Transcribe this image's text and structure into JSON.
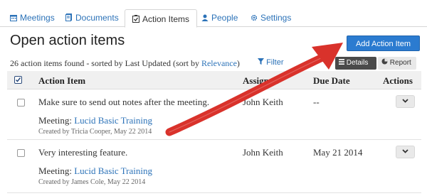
{
  "tabs": [
    {
      "label": "Meetings",
      "icon": "calendar-icon"
    },
    {
      "label": "Documents",
      "icon": "document-icon"
    },
    {
      "label": "Action Items",
      "icon": "checkbox-icon"
    },
    {
      "label": "People",
      "icon": "person-icon"
    },
    {
      "label": "Settings",
      "icon": "gear-icon"
    }
  ],
  "page_title": "Open action items",
  "add_button": "Add Action Item",
  "summary": {
    "prefix": "26 action items found - sorted by Last Updated (sort by ",
    "link": "Relevance",
    "suffix": ")"
  },
  "filter_label": "Filter",
  "view_buttons": {
    "details": "Details",
    "report": "Report"
  },
  "columns": {
    "action_item": "Action Item",
    "assigned": "Assigned",
    "due_date": "Due Date",
    "actions": "Actions"
  },
  "rows": [
    {
      "title": "Make sure to send out notes after the meeting.",
      "meeting_label": "Meeting:",
      "meeting": "Lucid Basic Training",
      "created": "Created by Tricia Cooper, May 22 2014",
      "assigned": "John Keith",
      "due": "--"
    },
    {
      "title": "Very interesting feature.",
      "meeting_label": "Meeting:",
      "meeting": "Lucid Basic Training",
      "created": "Created by James Cole, May 22 2014",
      "assigned": "John Keith",
      "due": "May 21 2014"
    }
  ],
  "colors": {
    "accent": "#2b7bd0",
    "link": "#2b72b8",
    "arrow": "#d9322b"
  }
}
